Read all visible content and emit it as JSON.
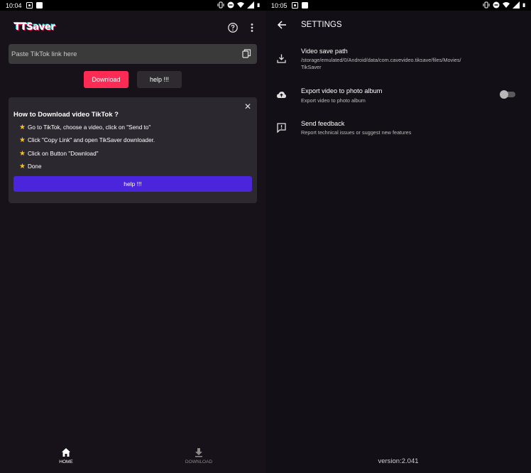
{
  "left": {
    "status": {
      "time": "10:04"
    },
    "app_logo": "TTSaver",
    "link_input": {
      "placeholder": "Paste TikTok link here"
    },
    "buttons": {
      "download": "Download",
      "help": "help !!!"
    },
    "card": {
      "title": "How to Download video TikTok ?",
      "steps": [
        "Go to TikTok, choose a video, click on \"Send to\"",
        "Click \"Copy Link\" and open TikSaver downloader.",
        "Click on Button \"Download\"",
        "Done"
      ],
      "help_button": "help !!!"
    },
    "nav": {
      "home": "HOME",
      "download": "DOWNLOAD"
    },
    "icons": [
      "help-circle-icon",
      "more-vert-icon",
      "paste-icon",
      "star-icon",
      "close-icon",
      "home-icon",
      "download-icon"
    ],
    "colors": {
      "accent_red": "#fe2c55",
      "accent_blue": "#4a25dc",
      "background": "#17121a"
    }
  },
  "right": {
    "status": {
      "time": "10:05"
    },
    "title": "SETTINGS",
    "settings": [
      {
        "title": "Video save path",
        "subtitle": "/storage/emulated/0/Android/data/com.cavevideo.tiksave/files/Movies/\nTikSaver"
      },
      {
        "title": "Export video to photo album",
        "subtitle": "Export video to photo album",
        "toggle_on": false
      },
      {
        "title": "Send feedback",
        "subtitle": "Report technical issues or suggest new features"
      }
    ],
    "version": "version:2.041"
  }
}
